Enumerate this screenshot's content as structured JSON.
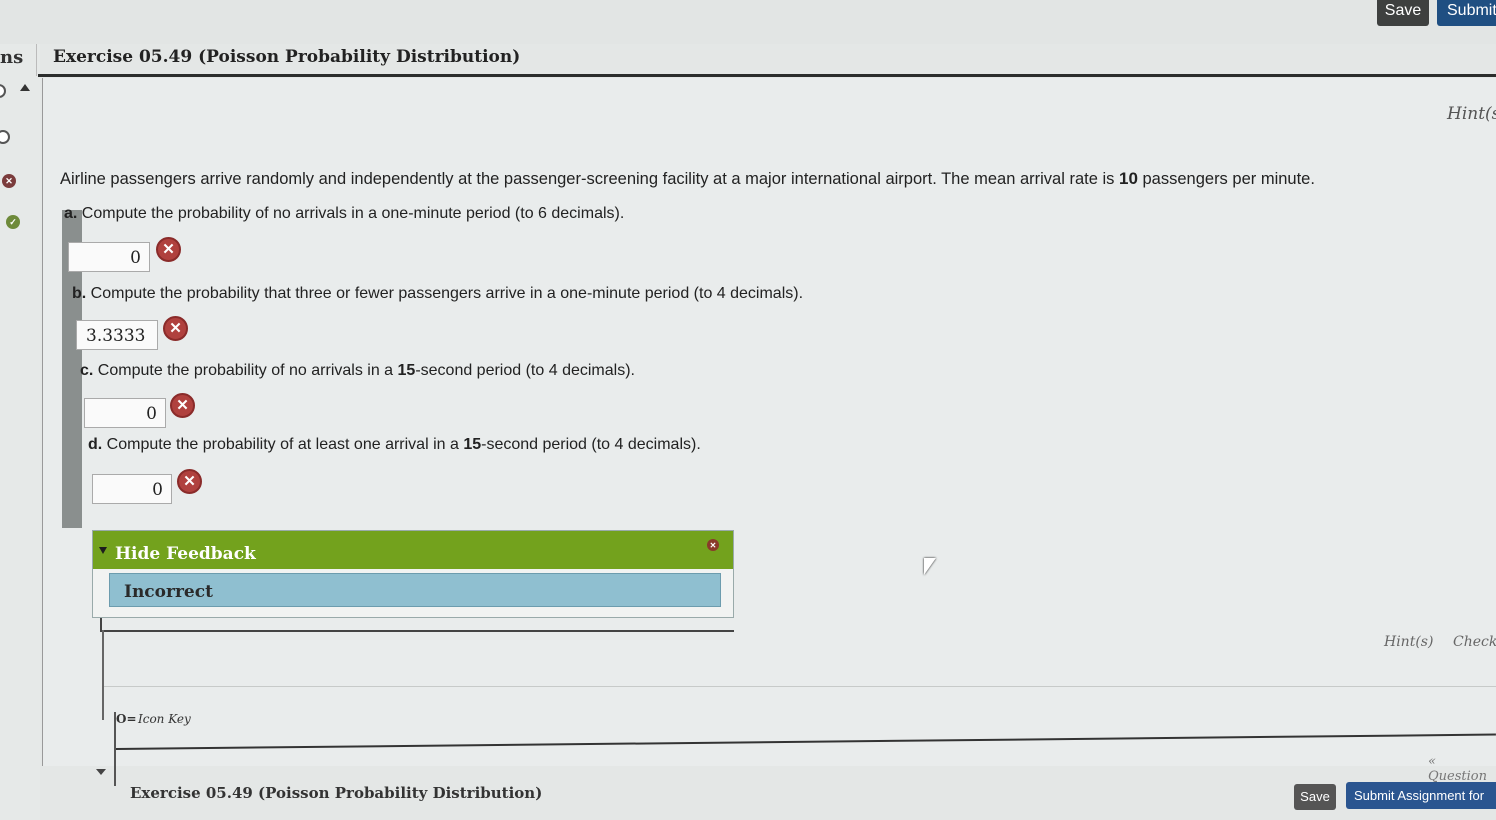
{
  "toolbar": {
    "save_label": "Save",
    "submit_label": "Submit"
  },
  "nav": {
    "title": "ns",
    "items": [
      {
        "status": "incorrect",
        "icon": "x-circle-icon",
        "glyph": "✕"
      },
      {
        "status": "unanswered",
        "icon": "empty-circle-icon",
        "glyph": ""
      },
      {
        "status": "incorrect",
        "icon": "x-circle-icon",
        "glyph": "✕"
      },
      {
        "status": "correct",
        "icon": "check-circle-icon",
        "glyph": "✓"
      }
    ]
  },
  "exercise": {
    "title": "Exercise 05.49 (Poisson Probability Distribution)",
    "hint_label": "Hint(s",
    "question_text_1": "Airline passengers arrive randomly and independently at the passenger-screening facility at a major international airport. The mean arrival rate is ",
    "question_value": "10",
    "question_text_2": " passengers per minute.",
    "parts": [
      {
        "label": "a.",
        "text": "Compute the probability of no arrivals in a one-minute period (to 6 decimals).",
        "answer": "0"
      },
      {
        "label": "b.",
        "text": "Compute the probability that three or fewer passengers arrive in a one-minute period (to 4 decimals).",
        "answer": "3.3333"
      },
      {
        "label": "c.",
        "text_1": "Compute the probability of no arrivals in a ",
        "value": "15",
        "text_2": "-second period (to 4 decimals).",
        "answer": "0"
      },
      {
        "label": "d.",
        "text_1": "Compute the probability of at least one arrival in a ",
        "value": "15",
        "text_2": "-second period (to 4 decimals).",
        "answer": "0"
      }
    ],
    "error_glyph": "✕"
  },
  "feedback": {
    "toggle_label": "Hide Feedback",
    "result": "Incorrect",
    "close_glyph": "✕"
  },
  "bottom_actions": {
    "hint_label": "Hint(s)",
    "check_label": "Check"
  },
  "icon_key": {
    "glyph": "O=",
    "label": "Icon Key"
  },
  "question_nav": "« Question",
  "footer": {
    "title": "Exercise 05.49 (Poisson Probability Distribution)",
    "save_label": "Save",
    "submit_label": "Submit Assignment for"
  }
}
